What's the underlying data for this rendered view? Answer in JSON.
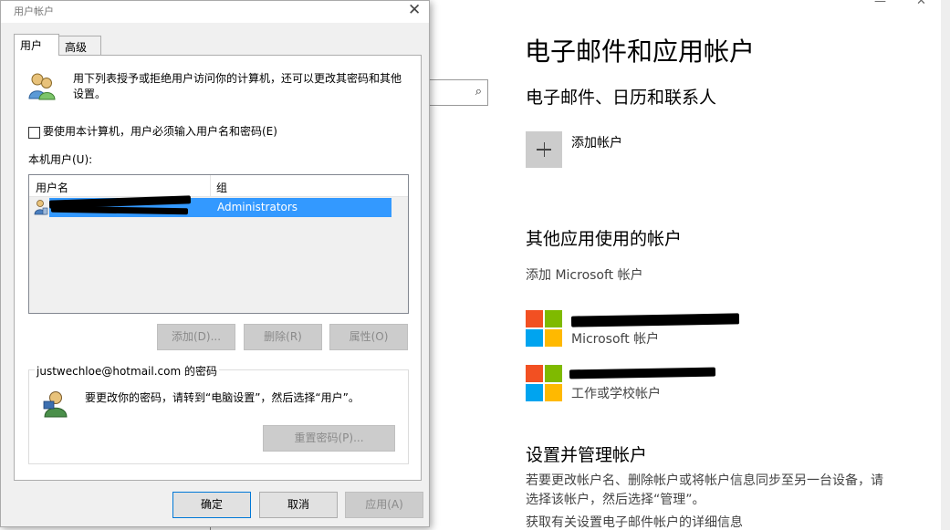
{
  "settings": {
    "title": "电子邮件和应用帐户",
    "section_email": "电子邮件、日历和联系人",
    "add_account": "添加帐户",
    "section_other": "其他应用使用的帐户",
    "add_ms_account": "添加 Microsoft 帐户",
    "account1_type": "Microsoft 帐户",
    "account2_type": "工作或学校帐户",
    "section_manage": "设置并管理帐户",
    "manage_desc_1": "若要更改帐户名、删除帐户或将帐户信息同步至另一台设备，请",
    "manage_desc_2": "选择该帐户，然后选择“管理”。",
    "email_setup_link": "获取有关设置电子邮件帐户的详细信息",
    "win_min": "—",
    "win_max": "□",
    "win_close": "✕",
    "search_icon": "⌕",
    "colors": {
      "ms_red": "#f25022",
      "ms_green": "#7fba00",
      "ms_blue": "#00a4ef",
      "ms_yellow": "#ffb900"
    }
  },
  "dialog": {
    "title": "用户帐户",
    "close": "✕",
    "tabs": [
      {
        "label": "用户"
      },
      {
        "label": "高级"
      }
    ],
    "intro_line1": "用下列表授予或拒绝用户访问你的计算机，还可以更改其密码和其他",
    "intro_line2": "设置。",
    "require_login_label": "要使用本计算机，用户必须输入用户名和密码(E)",
    "local_users_label": "本机用户(U):",
    "columns": [
      "用户名",
      "组"
    ],
    "rows": [
      {
        "username": "",
        "group": "Administrators"
      }
    ],
    "btn_add": "添加(D)...",
    "btn_remove": "删除(R)",
    "btn_properties": "属性(O)",
    "password_group_label": "justwechloe@hotmail.com 的密码",
    "password_text": "要更改你的密码，请转到“电脑设置”，然后选择“用户”。",
    "btn_reset_password": "重置密码(P)...",
    "btn_ok": "确定",
    "btn_cancel": "取消",
    "btn_apply": "应用(A)"
  }
}
